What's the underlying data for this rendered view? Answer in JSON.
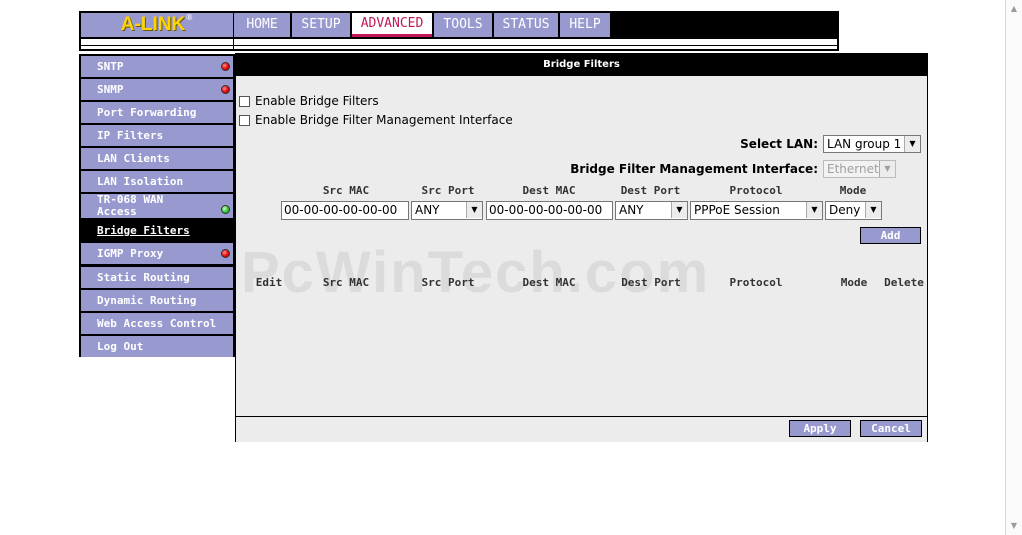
{
  "brand": {
    "logo_text": "A-LINK",
    "logo_mark": "®",
    "logo_color": "#ffd400",
    "accent": "#9799cf",
    "active_tab_color": "#c0185a"
  },
  "nav": {
    "tabs": [
      {
        "label": "HOME"
      },
      {
        "label": "SETUP"
      },
      {
        "label": "ADVANCED"
      },
      {
        "label": "TOOLS"
      },
      {
        "label": "STATUS"
      },
      {
        "label": "HELP"
      }
    ],
    "active": "ADVANCED"
  },
  "sidebar": {
    "items": [
      {
        "label": "SNTP",
        "status": "red"
      },
      {
        "label": "SNMP",
        "status": "red"
      },
      {
        "label": "Port Forwarding"
      },
      {
        "label": "IP Filters"
      },
      {
        "label": "LAN Clients"
      },
      {
        "label": "LAN Isolation"
      },
      {
        "label": "TR-068 WAN Access",
        "status": "green"
      },
      {
        "label": "Bridge Filters",
        "active": true
      },
      {
        "label": "IGMP Proxy",
        "status": "red"
      },
      {
        "label": "Static Routing"
      },
      {
        "label": "Dynamic Routing"
      },
      {
        "label": "Web Access Control"
      },
      {
        "label": "Log Out"
      }
    ]
  },
  "panel": {
    "title": "Bridge Filters",
    "enable_bridge_filters": "Enable Bridge Filters",
    "enable_mgmt_interface": "Enable Bridge Filter Management Interface",
    "select_lan_label": "Select LAN:",
    "select_lan_value": "LAN group 1",
    "mgmt_interface_label": "Bridge Filter Management Interface:",
    "mgmt_interface_value": "Ethernet",
    "columns": {
      "src_mac": "Src MAC",
      "src_port": "Src Port",
      "dest_mac": "Dest MAC",
      "dest_port": "Dest Port",
      "protocol": "Protocol",
      "mode": "Mode"
    },
    "form": {
      "src_mac": "00-00-00-00-00-00",
      "src_port": "ANY",
      "dest_mac": "00-00-00-00-00-00",
      "dest_port": "ANY",
      "protocol": "PPPoE Session",
      "mode": "Deny"
    },
    "add_label": "Add",
    "table_headers": {
      "edit": "Edit",
      "src_mac": "Src MAC",
      "src_port": "Src Port",
      "dest_mac": "Dest MAC",
      "dest_port": "Dest Port",
      "protocol": "Protocol",
      "mode": "Mode",
      "delete": "Delete"
    },
    "apply_label": "Apply",
    "cancel_label": "Cancel"
  },
  "watermark": "PcWinTech.com"
}
